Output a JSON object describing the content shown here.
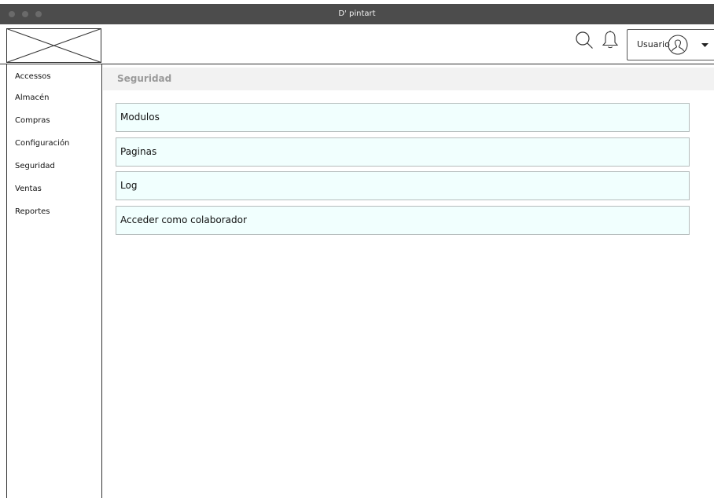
{
  "window": {
    "title": "D' pintart"
  },
  "header": {
    "icons": [
      "logo-placeholder",
      "search-icon",
      "bell-icon",
      "user-avatar-icon",
      "caret-down-icon"
    ],
    "user_label": "Usuario"
  },
  "sidebar": {
    "items": [
      {
        "label": "Accessos"
      },
      {
        "label": "Almacén"
      },
      {
        "label": "Compras"
      },
      {
        "label": "Configuración"
      },
      {
        "label": "Seguridad"
      },
      {
        "label": "Ventas"
      },
      {
        "label": "Reportes"
      }
    ]
  },
  "main": {
    "section_title": "Seguridad",
    "options": [
      {
        "label": "Modulos"
      },
      {
        "label": "Paginas"
      },
      {
        "label": "Log"
      },
      {
        "label": "Acceder como colaborador"
      }
    ]
  },
  "colors": {
    "titlebar": "#4c4c4c",
    "option_background": "#f1fffe",
    "section_header_background": "#f2f2f2"
  }
}
